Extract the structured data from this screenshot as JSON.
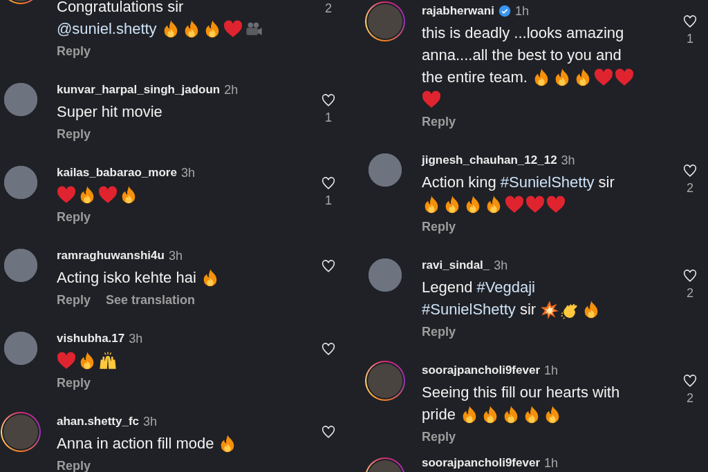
{
  "columns": [
    {
      "comments": [
        {
          "avatar": {
            "story_ring": true
          },
          "lines": [
            {
              "text": [
                {
                  "kind": "plain",
                  "text": "Congratulations sir"
                }
              ]
            },
            {
              "text": [
                {
                  "kind": "mention",
                  "text": "@suniel.shetty"
                }
              ],
              "emojis": [
                {
                  "kind": "fire"
                },
                {
                  "kind": "fire"
                },
                {
                  "kind": "fire"
                },
                {
                  "kind": "heart"
                },
                {
                  "kind": "camera"
                }
              ]
            }
          ],
          "actions": [
            "Reply"
          ],
          "likes": "2"
        },
        {
          "avatar": {
            "story_ring": false
          },
          "username": "kunvar_harpal_singh_jadoun",
          "verified": false,
          "time": "2h",
          "lines": [
            {
              "text": [
                {
                  "kind": "plain",
                  "text": "Super hit movie"
                }
              ]
            }
          ],
          "actions": [
            "Reply"
          ],
          "likes": "1"
        },
        {
          "avatar": {
            "story_ring": false
          },
          "username": "kailas_babarao_more",
          "verified": false,
          "time": "3h",
          "lines": [
            {
              "emojis": [
                {
                  "kind": "heart"
                },
                {
                  "kind": "fire"
                },
                {
                  "kind": "heart"
                },
                {
                  "kind": "fire"
                }
              ]
            }
          ],
          "actions": [
            "Reply"
          ],
          "likes": "1"
        },
        {
          "avatar": {
            "story_ring": false
          },
          "username": "ramraghuwanshi4u",
          "verified": false,
          "time": "3h",
          "lines": [
            {
              "text": [
                {
                  "kind": "plain",
                  "text": "Acting isko kehte hai"
                }
              ],
              "emojis": [
                {
                  "kind": "fire"
                }
              ]
            }
          ],
          "actions": [
            "Reply",
            "See translation"
          ]
        },
        {
          "avatar": {
            "story_ring": false
          },
          "username": "vishubha.17",
          "verified": false,
          "time": "3h",
          "lines": [
            {
              "emojis": [
                {
                  "kind": "heart"
                },
                {
                  "kind": "fire"
                },
                {
                  "kind": "raised_hands"
                }
              ]
            }
          ],
          "actions": [
            "Reply"
          ]
        },
        {
          "avatar": {
            "story_ring": true
          },
          "username": "ahan.shetty_fc",
          "verified": false,
          "time": "3h",
          "lines": [
            {
              "text": [
                {
                  "kind": "plain",
                  "text": "Anna in action fill mode"
                }
              ],
              "emojis": [
                {
                  "kind": "fire"
                }
              ]
            }
          ],
          "actions": [
            "Reply"
          ]
        }
      ]
    },
    {
      "comments": [
        {
          "avatar": {
            "story_ring": true
          },
          "username": "rajabherwani",
          "verified": true,
          "time": "1h",
          "lines": [
            {
              "text": [
                {
                  "kind": "plain",
                  "text": "this is deadly ...looks amazing"
                }
              ]
            },
            {
              "text": [
                {
                  "kind": "plain",
                  "text": "anna....all the best to you and"
                }
              ]
            },
            {
              "text": [
                {
                  "kind": "plain",
                  "text": "the entire team."
                }
              ],
              "emojis": [
                {
                  "kind": "fire"
                },
                {
                  "kind": "fire"
                },
                {
                  "kind": "fire"
                },
                {
                  "kind": "heart"
                },
                {
                  "kind": "heart"
                }
              ]
            },
            {
              "emojis": [
                {
                  "kind": "heart"
                }
              ]
            }
          ],
          "actions": [
            "Reply"
          ],
          "likes": "1"
        },
        {
          "avatar": {
            "story_ring": false
          },
          "username": "jignesh_chauhan_12_12",
          "verified": false,
          "time": "3h",
          "lines": [
            {
              "text": [
                {
                  "kind": "plain",
                  "text": "Action king "
                },
                {
                  "kind": "tag",
                  "text": "#SunielShetty"
                },
                {
                  "kind": "plain",
                  "text": " sir"
                }
              ]
            },
            {
              "emojis": [
                {
                  "kind": "fire"
                },
                {
                  "kind": "fire"
                },
                {
                  "kind": "fire"
                },
                {
                  "kind": "fire"
                },
                {
                  "kind": "heart"
                },
                {
                  "kind": "heart"
                },
                {
                  "kind": "heart"
                }
              ]
            }
          ],
          "actions": [
            "Reply"
          ],
          "likes": "2"
        },
        {
          "avatar": {
            "story_ring": false
          },
          "username": "ravi_sindal_",
          "verified": false,
          "time": "3h",
          "lines": [
            {
              "text": [
                {
                  "kind": "plain",
                  "text": "Legend "
                },
                {
                  "kind": "tag",
                  "text": "#Vegdaji"
                }
              ]
            },
            {
              "text": [
                {
                  "kind": "tag",
                  "text": "#SunielShetty"
                },
                {
                  "kind": "plain",
                  "text": " sir"
                }
              ],
              "emojis": [
                {
                  "kind": "collision"
                },
                {
                  "kind": "clap"
                },
                {
                  "kind": "fire"
                }
              ]
            }
          ],
          "actions": [
            "Reply"
          ],
          "likes": "2"
        },
        {
          "avatar": {
            "story_ring": true
          },
          "username": "soorajpancholi9fever",
          "verified": false,
          "time": "1h",
          "lines": [
            {
              "text": [
                {
                  "kind": "plain",
                  "text": "Seeing this fill our hearts with"
                }
              ]
            },
            {
              "text": [
                {
                  "kind": "plain",
                  "text": "pride"
                }
              ],
              "emojis": [
                {
                  "kind": "fire"
                },
                {
                  "kind": "fire"
                },
                {
                  "kind": "fire"
                },
                {
                  "kind": "fire"
                },
                {
                  "kind": "fire"
                }
              ]
            }
          ],
          "actions": [
            "Reply"
          ],
          "likes": "2"
        },
        {
          "avatar": {
            "story_ring": true
          },
          "username": "soorajpancholi9fever",
          "verified": false,
          "time": "1h"
        }
      ]
    }
  ]
}
